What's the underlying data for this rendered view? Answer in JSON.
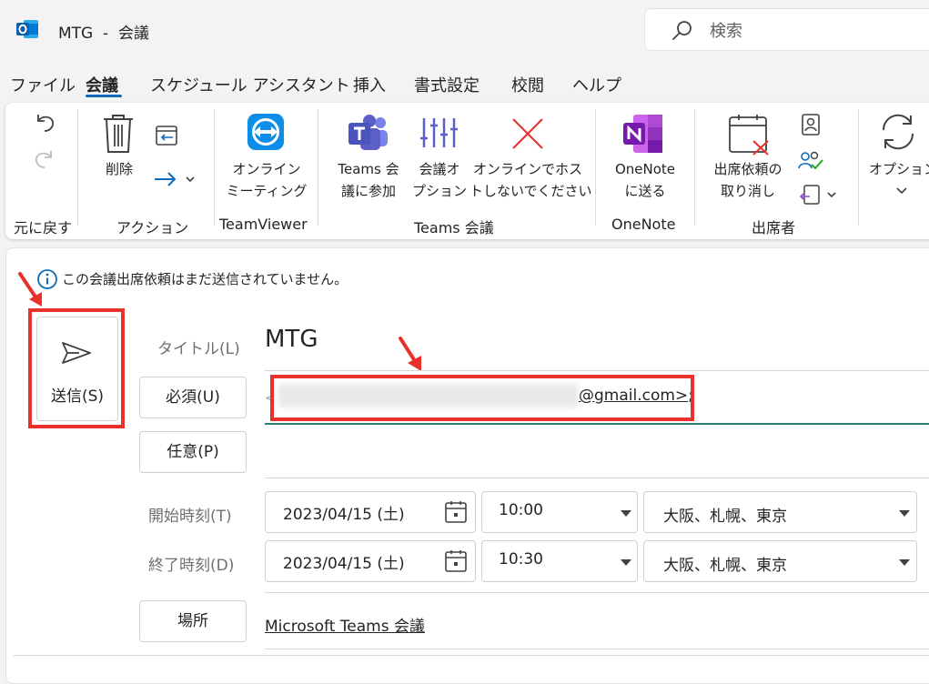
{
  "window": {
    "title": "MTG  -  会議",
    "search_placeholder": "検索"
  },
  "menu_tabs": [
    "ファイル",
    "会議",
    "スケジュール アシスタント",
    "挿入",
    "書式設定",
    "校閲",
    "ヘルプ"
  ],
  "active_tab": "会議",
  "ribbon": {
    "undo_group": "元に戻す",
    "delete_label": "削除",
    "action_group": "アクション",
    "online_meeting_label_1": "オンライン",
    "online_meeting_label_2": "ミーティング",
    "teamviewer_group": "TeamViewer",
    "teams_join_1": "Teams 会",
    "teams_join_2": "議に参加",
    "meeting_options_1": "会議オ",
    "meeting_options_2": "プション",
    "no_online_1": "オンラインでホス",
    "no_online_2": "トしないでください",
    "teams_group": "Teams 会議",
    "onenote_1": "OneNote",
    "onenote_2": "に送る",
    "onenote_group": "OneNote",
    "cancel_invite_1": "出席依頼の",
    "cancel_invite_2": "取り消し",
    "attendees_group": "出席者",
    "options_label": "オプション"
  },
  "info_bar": "この会議出席依頼はまだ送信されていません。",
  "form": {
    "send_label": "送信(S)",
    "title_label": "タイトル(L)",
    "title_value": "MTG",
    "required_label": "必須(U)",
    "required_value": "@gmail.com>;",
    "optional_label": "任意(P)",
    "start_label": "開始時刻(T)",
    "start_date": "2023/04/15 (土)",
    "start_time": "10:00",
    "start_tz": "大阪、札幌、東京",
    "end_label": "終了時刻(D)",
    "end_date": "2023/04/15 (土)",
    "end_time": "10:30",
    "end_tz": "大阪、札幌、東京",
    "location_label": "場所",
    "location_value": "Microsoft Teams 会議"
  },
  "colors": {
    "accent": "#0f6cbd",
    "annotation_red": "#e8302c",
    "teams_purple": "#5b5fc7",
    "onenote_purple": "#7719aa",
    "teamviewer_blue": "#0e8ee9"
  }
}
